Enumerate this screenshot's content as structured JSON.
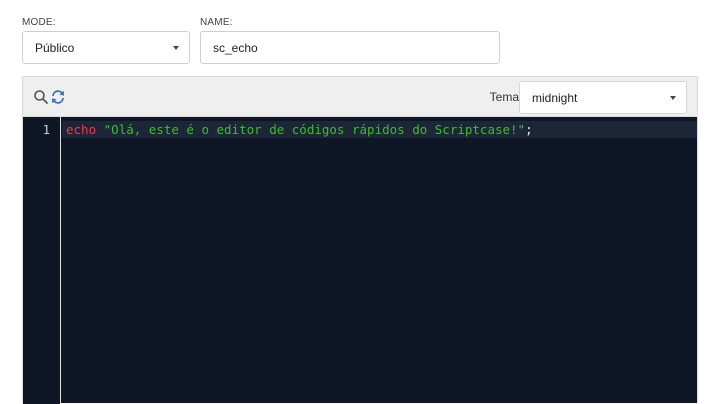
{
  "form": {
    "mode": {
      "label": "MODE:",
      "value": "Público"
    },
    "name": {
      "label": "NAME:",
      "value": "sc_echo"
    }
  },
  "editor": {
    "toolbar": {
      "search_icon": "search-icon",
      "refresh_icon": "refresh-icon",
      "theme_label": "Tema",
      "theme_value": "midnight"
    },
    "lines": [
      {
        "number": "1",
        "keyword": "echo",
        "string": "\"Olá, este é o editor de códigos rápidos do Scriptcase!\"",
        "punct": ";"
      }
    ],
    "colors": {
      "background": "#0f1626",
      "keyword": "#f2384b",
      "string": "#3bbd2a",
      "icon_accent": "#3a6fb8"
    }
  }
}
